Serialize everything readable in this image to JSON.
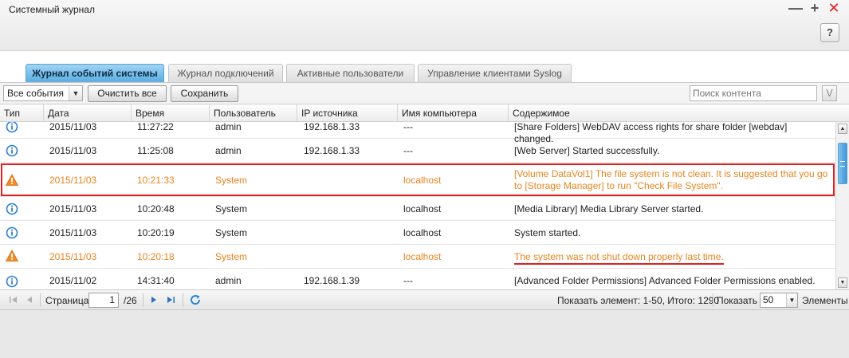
{
  "window": {
    "title": "Системный журнал",
    "help_label": "?"
  },
  "tabs": [
    {
      "label": "Журнал событий системы",
      "active": true
    },
    {
      "label": "Журнал подключений",
      "active": false
    },
    {
      "label": "Активные пользователи",
      "active": false
    },
    {
      "label": "Управление клиентами Syslog",
      "active": false
    }
  ],
  "toolbar": {
    "filter_value": "Все события",
    "clear_label": "Очистить все",
    "save_label": "Сохранить",
    "search_placeholder": "Поиск контента"
  },
  "table": {
    "headers": {
      "type": "Тип",
      "date": "Дата",
      "time": "Время",
      "user": "Пользователь",
      "ip": "IP источника",
      "host": "Имя компьютера",
      "content": "Содержимое"
    },
    "rows": [
      {
        "type": "info",
        "date": "2015/11/03",
        "time": "11:27:22",
        "user": "admin",
        "ip": "192.168.1.33",
        "host": "---",
        "content": "[Share Folders] WebDAV access rights for share folder [webdav] changed."
      },
      {
        "type": "info",
        "date": "2015/11/03",
        "time": "11:25:08",
        "user": "admin",
        "ip": "192.168.1.33",
        "host": "---",
        "content": "[Web Server] Started successfully."
      },
      {
        "type": "warning",
        "date": "2015/11/03",
        "time": "10:21:33",
        "user": "System",
        "ip": "",
        "host": "localhost",
        "content": "[Volume DataVol1] The file system is not clean. It is suggested that you go to [Storage Manager] to run \"Check File System\"."
      },
      {
        "type": "info",
        "date": "2015/11/03",
        "time": "10:20:48",
        "user": "System",
        "ip": "",
        "host": "localhost",
        "content": "[Media Library] Media Library Server started."
      },
      {
        "type": "info",
        "date": "2015/11/03",
        "time": "10:20:19",
        "user": "System",
        "ip": "",
        "host": "localhost",
        "content": "System started."
      },
      {
        "type": "warning",
        "date": "2015/11/03",
        "time": "10:20:18",
        "user": "System",
        "ip": "",
        "host": "localhost",
        "content": "The system was not shut down properly last time."
      },
      {
        "type": "info",
        "date": "2015/11/02",
        "time": "14:31:40",
        "user": "admin",
        "ip": "192.168.1.39",
        "host": "---",
        "content": "[Advanced Folder Permissions] Advanced Folder Permissions enabled."
      }
    ]
  },
  "pager": {
    "page_label": "Страница",
    "page_value": "1",
    "total_pages": "/26",
    "display_info": "Показать элемент: 1-50, Итого: 1290",
    "show_label": "Показать",
    "page_size": "50",
    "items_label": "Элементы"
  },
  "colors": {
    "warning": "#e8841e",
    "info_icon": "#2b7fd0",
    "highlight": "#e02020",
    "tab_active": "#59aee0"
  }
}
